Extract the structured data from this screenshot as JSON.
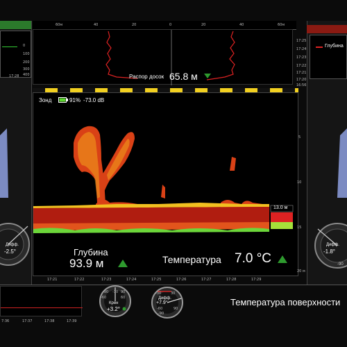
{
  "top_chart": {
    "x_ticks": [
      "60м",
      "40",
      "20",
      "0",
      "20",
      "40",
      "60м"
    ],
    "time_ticks": [
      "17:25",
      "17:24",
      "17:23",
      "17:22",
      "17:21",
      "17:20",
      "16:56"
    ],
    "spread_label": "Распор досок",
    "spread_value": "65.8 м"
  },
  "left_top": {
    "ticks": [
      "0",
      "100",
      "200",
      "300",
      "400"
    ],
    "time": "17:28"
  },
  "right_top": {
    "legend": "Глубина"
  },
  "sonar": {
    "label": "Зонд",
    "battery": "91%",
    "signal": "-73.0 dB",
    "bottom_marker": "13.0 м",
    "depth_ticks": [
      "5",
      "10",
      "15",
      "20 м"
    ],
    "time_ticks": [
      "17:21",
      "17:22",
      "17:23",
      "17:24",
      "17:25",
      "17:26",
      "17:27",
      "17:28",
      "17:29"
    ],
    "depth_label": "Глубина",
    "depth_value": "93.9 м",
    "temp_label": "Температура",
    "temp_value": "7.0 °C"
  },
  "left_gauge": {
    "diff_label": "Дифф.",
    "diff_value": "-2.5°"
  },
  "right_gauge": {
    "diff_label": "Дифф.",
    "diff_value": "-1.8°",
    "scale_value": "-90"
  },
  "bottom_left": {
    "time_ticks": [
      "7:36",
      "17:37",
      "17:38",
      "17:39"
    ]
  },
  "roll_gauge": {
    "label": "Крен",
    "value": "+3.2°",
    "scale": [
      "-90",
      "-30",
      "-60",
      "60",
      "90"
    ]
  },
  "diff_gauge": {
    "label": "Дифф.",
    "value": "+7.9°",
    "scale": [
      "-30",
      "30",
      "-60",
      "-90",
      "90"
    ]
  },
  "surface_temp": {
    "label": "Температура поверхности"
  },
  "colors": {
    "accent_red": "#cc2a1e",
    "accent_green": "#38a838",
    "bottom_red": "#b01d10",
    "echo_orange": "#e2541c",
    "echo_yellow": "#f2c020"
  }
}
